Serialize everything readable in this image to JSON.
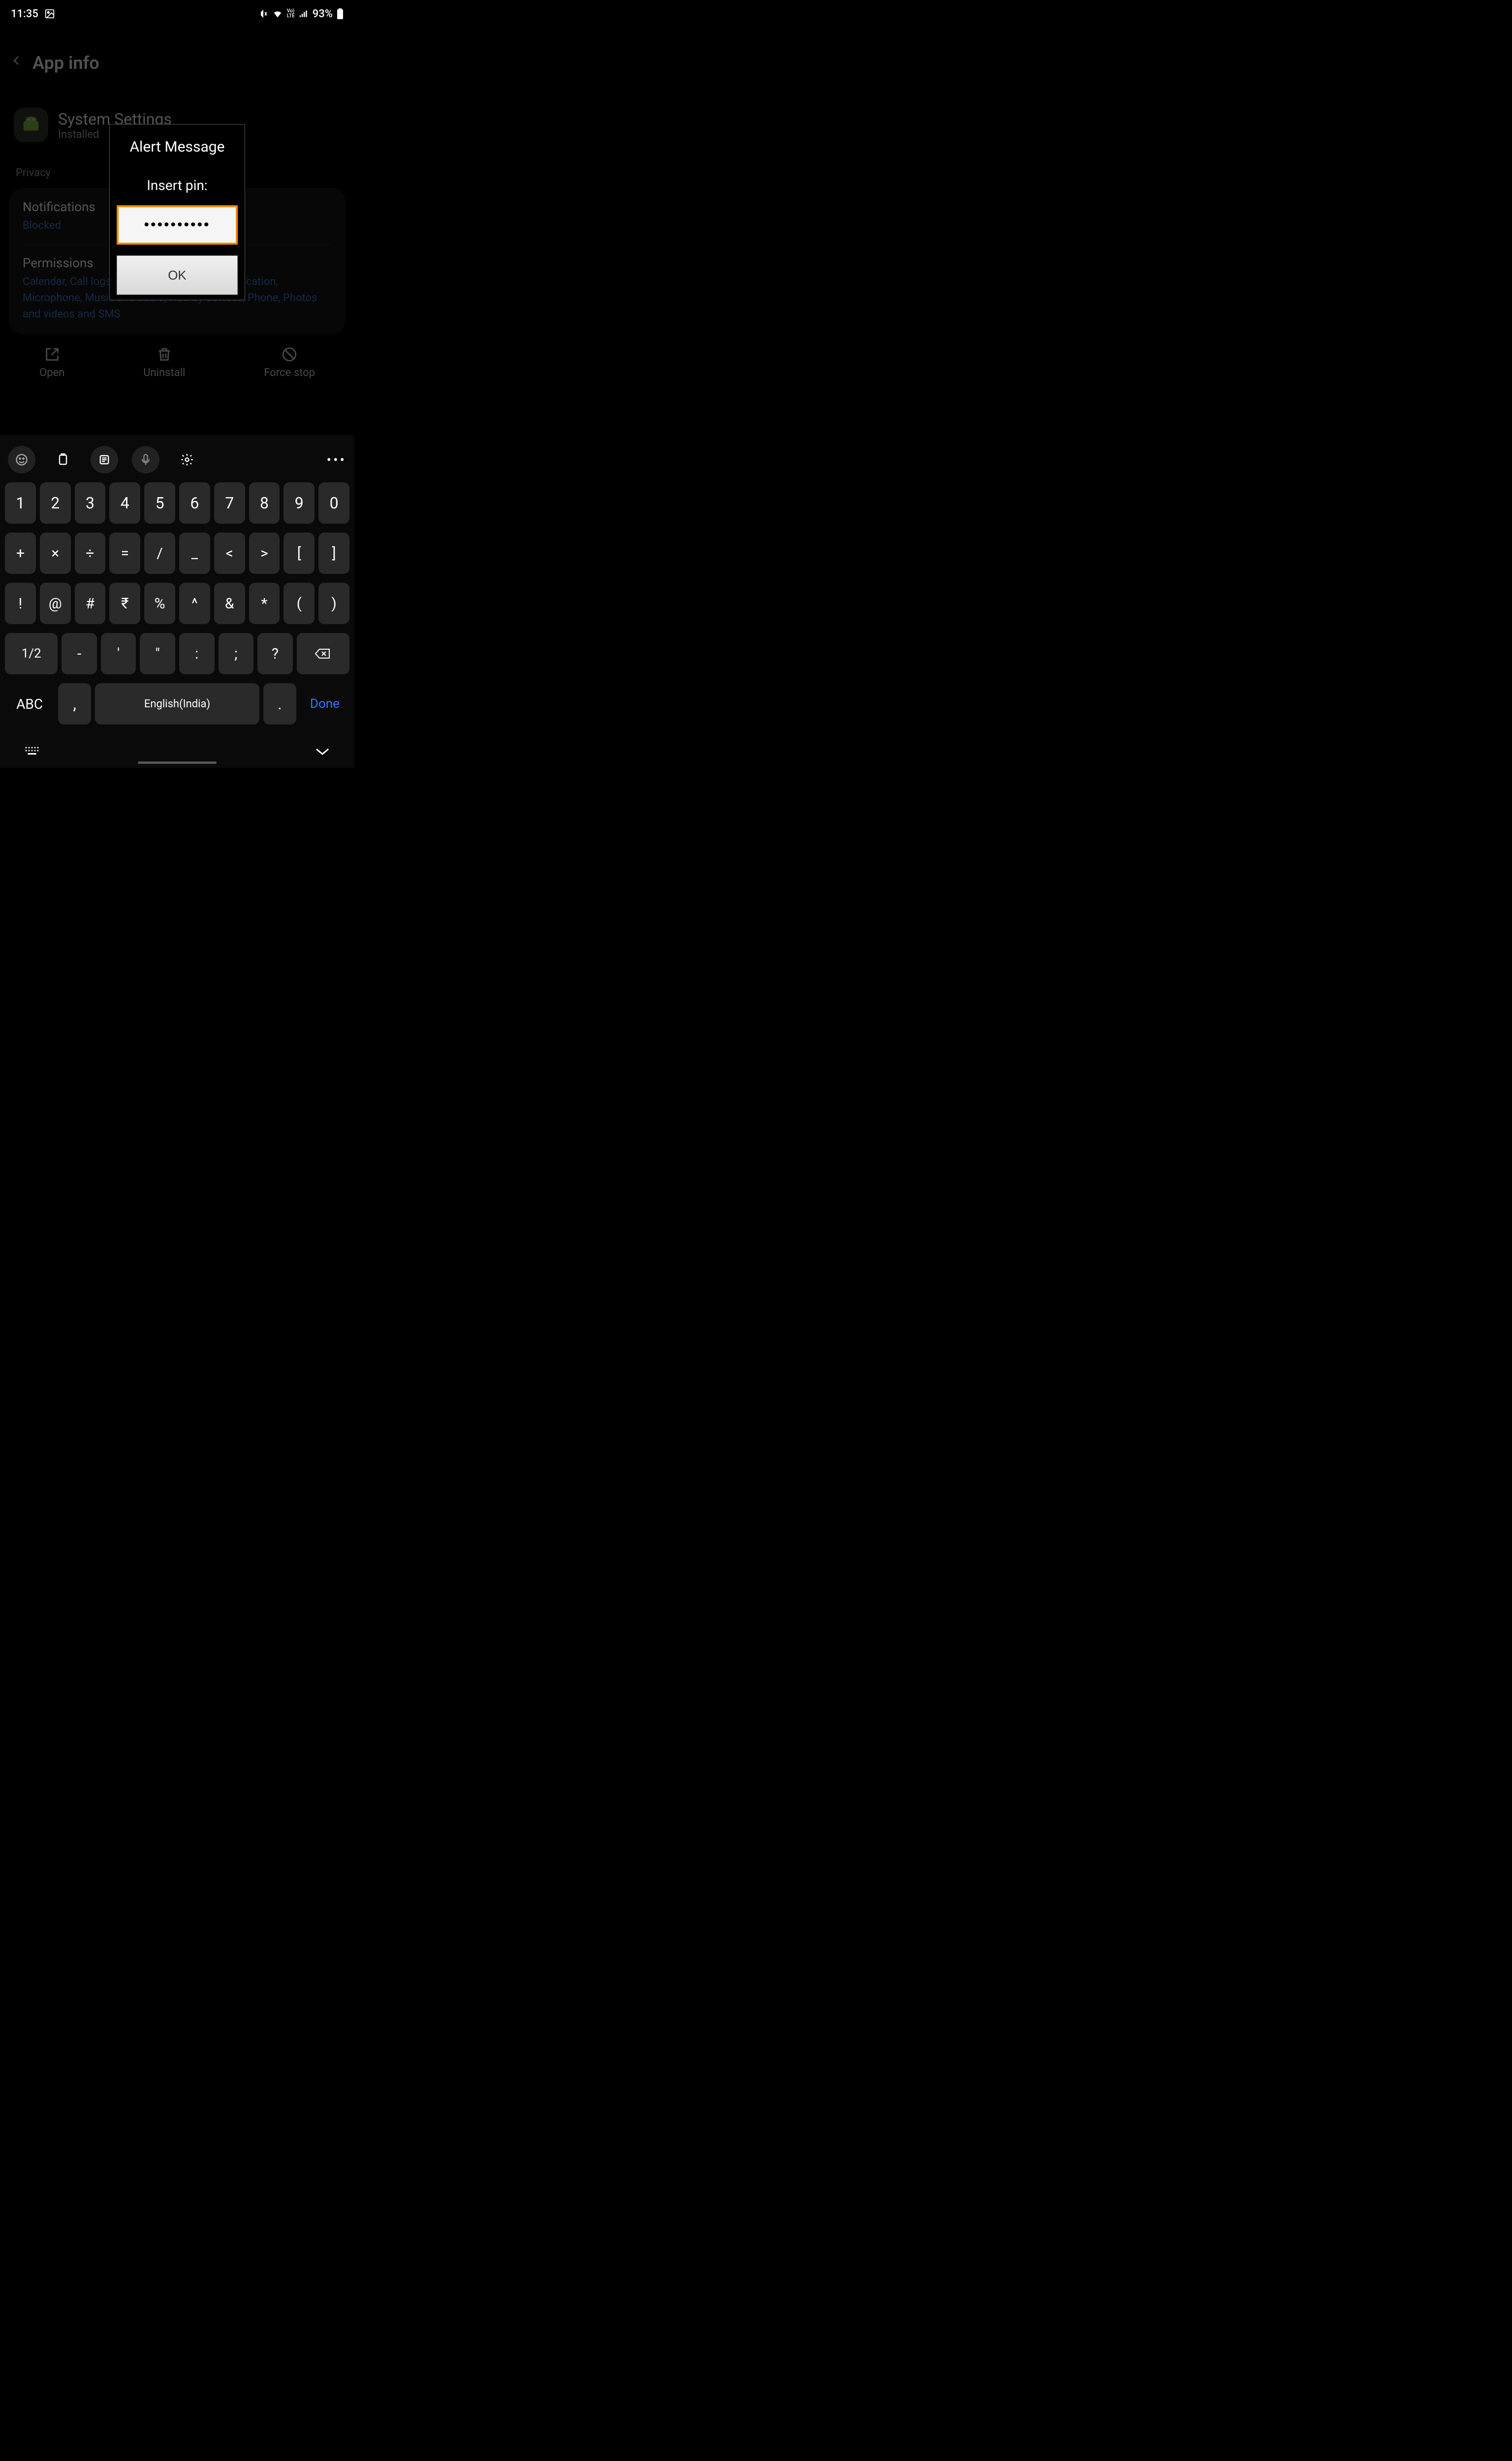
{
  "status": {
    "time": "11:35",
    "battery_pct": "93%"
  },
  "header": {
    "title": "App info"
  },
  "app": {
    "name": "System Settings",
    "subtitle": "Installed"
  },
  "privacy": {
    "section_label": "Privacy",
    "notifications_label": "Notifications",
    "notifications_status": "Blocked",
    "permissions_label": "Permissions",
    "permissions_list": "Calendar, Call logs, Camera, Contacts, Files, Location, Microphone, Music and audio, Nearby devices, Phone, Photos and videos and SMS"
  },
  "actions": {
    "open": "Open",
    "uninstall": "Uninstall",
    "force_stop": "Force stop"
  },
  "dialog": {
    "title": "Alert Message",
    "prompt": "Insert pin:",
    "pin_value": "••••••••••",
    "ok_label": "OK"
  },
  "keyboard": {
    "row1": [
      "1",
      "2",
      "3",
      "4",
      "5",
      "6",
      "7",
      "8",
      "9",
      "0"
    ],
    "row2": [
      "+",
      "×",
      "÷",
      "=",
      "/",
      "_",
      "<",
      ">",
      "[",
      "]"
    ],
    "row3": [
      "!",
      "@",
      "#",
      "₹",
      "%",
      "^",
      "&",
      "*",
      "(",
      ")"
    ],
    "row4_page": "1/2",
    "row4": [
      "-",
      "'",
      "\"",
      ":",
      ";",
      "?"
    ],
    "abc": "ABC",
    "comma": ",",
    "space": "English(India)",
    "period": ".",
    "done": "Done"
  }
}
